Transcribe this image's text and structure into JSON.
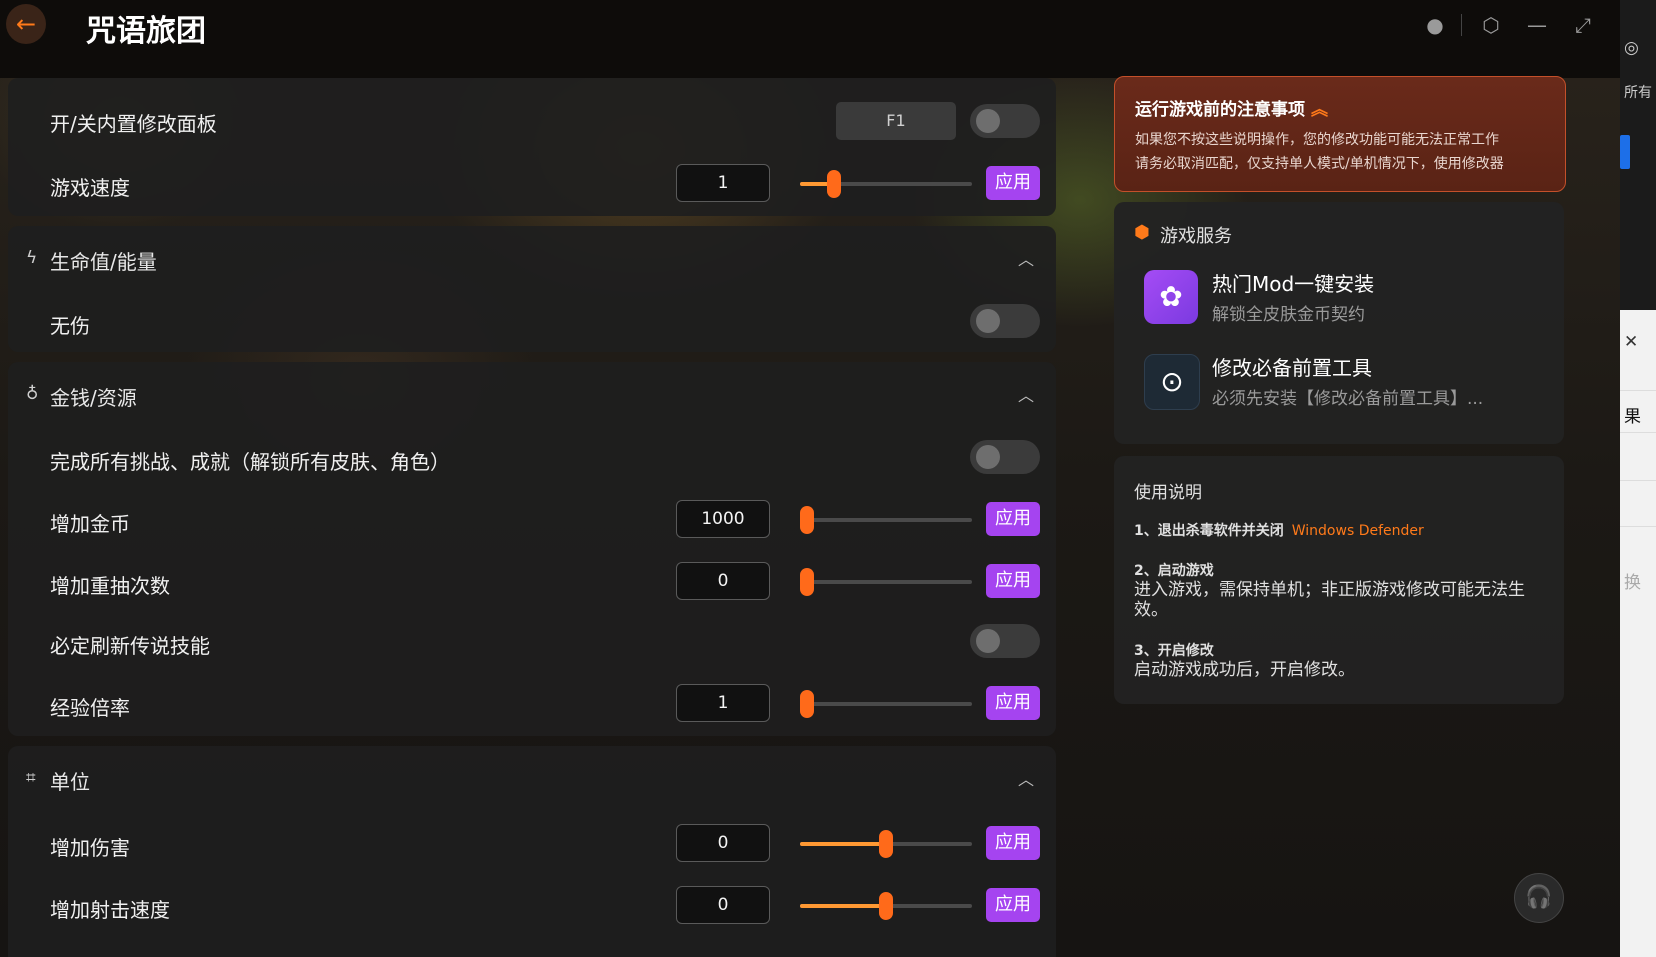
{
  "app": {
    "title": "咒语旅团"
  },
  "panel": {
    "top_rows": [
      {
        "label": "开/关内置修改面板",
        "key": "F1"
      },
      {
        "label": "游戏速度",
        "value": "1",
        "slider": 0.2
      }
    ],
    "apply_label": "应用",
    "sections": [
      {
        "title": "生命值/能量",
        "icon": "lightning-icon",
        "rows": [
          {
            "label": "无伤"
          }
        ]
      },
      {
        "title": "金钱/资源",
        "icon": "money-bag-icon",
        "rows": [
          {
            "label": "完成所有挑战、成就（解锁所有皮肤、角色）"
          },
          {
            "label": "增加金币",
            "value": "1000",
            "slider": 0.0
          },
          {
            "label": "增加重抽次数",
            "value": "0",
            "slider": 0.0
          },
          {
            "label": "必定刷新传说技能"
          },
          {
            "label": "经验倍率",
            "value": "1",
            "slider": 0.0
          }
        ]
      },
      {
        "title": "单位",
        "icon": "unit-icon",
        "rows": [
          {
            "label": "增加伤害",
            "value": "0",
            "slider": 0.5
          },
          {
            "label": "增加射击速度",
            "value": "0",
            "slider": 0.5
          }
        ]
      }
    ]
  },
  "notice": {
    "title": "运行游戏前的注意事项",
    "line1": "如果您不按这些说明操作，您的修改功能可能无法正常工作",
    "line2": "请务必取消匹配，仅支持单人模式/单机情况下，使用修改器"
  },
  "services": {
    "header": "游戏服务",
    "items": [
      {
        "title": "热门Mod一键安装",
        "subtitle": "解锁全皮肤金币契约",
        "icon": "mod-icon"
      },
      {
        "title": "修改必备前置工具",
        "subtitle": "必须先安装【修改必备前置工具】...",
        "icon": "download-icon"
      }
    ]
  },
  "usage": {
    "header": "使用说明",
    "step1_title": "1、退出杀毒软件并关闭",
    "step1_accent": "Windows Defender",
    "step2_title": "2、启动游戏",
    "step2_text": "进入游戏，需保持单机；非正版游戏修改可能无法生效。",
    "step3_title": "3、开启修改",
    "step3_text": "启动游戏成功后，开启修改。"
  },
  "strip": {
    "t1": "所有",
    "t2": "果",
    "t3": "换"
  },
  "colors": {
    "accent": "#ff7a1a",
    "apply": "#a544f0"
  }
}
